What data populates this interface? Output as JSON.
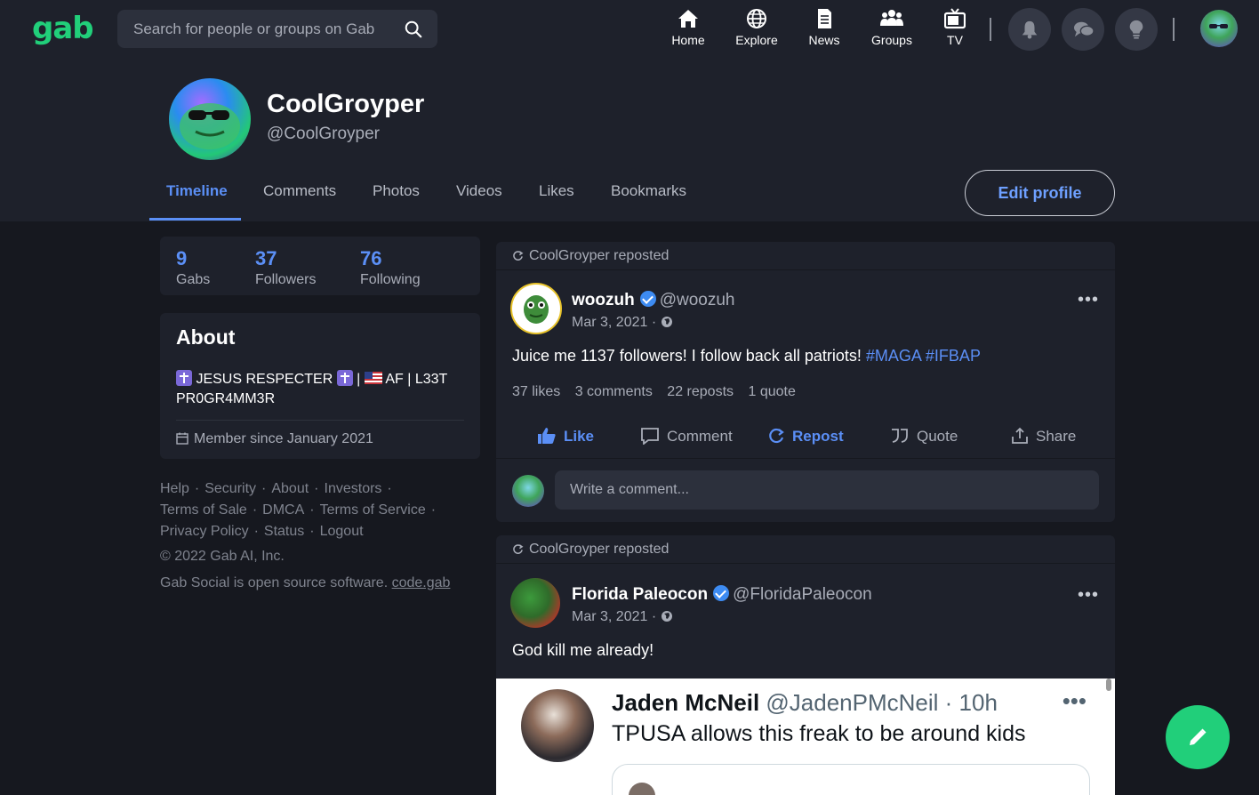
{
  "app": {
    "logo": "gab"
  },
  "search": {
    "placeholder": "Search for people or groups on Gab"
  },
  "nav": {
    "items": [
      {
        "label": "Home",
        "icon": "home-icon"
      },
      {
        "label": "Explore",
        "icon": "globe-icon"
      },
      {
        "label": "News",
        "icon": "newspaper-icon"
      },
      {
        "label": "Groups",
        "icon": "groups-icon"
      },
      {
        "label": "TV",
        "icon": "tv-icon"
      }
    ],
    "buttons": [
      "bell-icon",
      "chat-icon",
      "lightbulb-icon"
    ]
  },
  "profile": {
    "display_name": "CoolGroyper",
    "handle": "@CoolGroyper",
    "tabs": [
      "Timeline",
      "Comments",
      "Photos",
      "Videos",
      "Likes",
      "Bookmarks"
    ],
    "active_tab": "Timeline",
    "edit_label": "Edit profile"
  },
  "stats": [
    {
      "num": "9",
      "label": "Gabs"
    },
    {
      "num": "37",
      "label": "Followers"
    },
    {
      "num": "76",
      "label": "Following"
    }
  ],
  "about": {
    "title": "About",
    "bio_part1": "JESUS RESPECTER",
    "bio_sep": "|",
    "bio_part2": "AF | L33T PR0GR4MM3R",
    "member_since": "Member since January 2021"
  },
  "footer": {
    "links": [
      "Help",
      "Security",
      "About",
      "Investors",
      "Terms of Sale",
      "DMCA",
      "Terms of Service",
      "Privacy Policy",
      "Status",
      "Logout"
    ],
    "copyright": "© 2022 Gab AI, Inc.",
    "oss_text": "Gab Social is open source software.",
    "oss_link": "code.gab"
  },
  "posts": [
    {
      "repost_label": "CoolGroyper reposted",
      "author": "woozuh",
      "handle": "@woozuh",
      "date": "Mar 3, 2021",
      "text": "Juice me 1137 followers! I follow back all patriots!",
      "tags": [
        "#MAGA",
        "#IFBAP"
      ],
      "likes": "37 likes",
      "comments": "3 comments",
      "reposts": "22 reposts",
      "quotes": "1 quote",
      "actions": [
        "Like",
        "Comment",
        "Repost",
        "Quote",
        "Share"
      ],
      "comment_placeholder": "Write a comment..."
    },
    {
      "repost_label": "CoolGroyper reposted",
      "author": "Florida Paleocon",
      "handle": "@FloridaPaleocon",
      "date": "Mar 3, 2021",
      "text": "God kill me already!"
    }
  ],
  "embed": {
    "name": "Jaden McNeil",
    "handle": "@JadenPMcNeil · 10h",
    "more": "•••",
    "text": "TPUSA allows this freak to be around kids"
  },
  "colors": {
    "brand": "#21cf7a",
    "accent": "#5b8ff6",
    "bg": "#16181f",
    "card": "#1e212b"
  }
}
